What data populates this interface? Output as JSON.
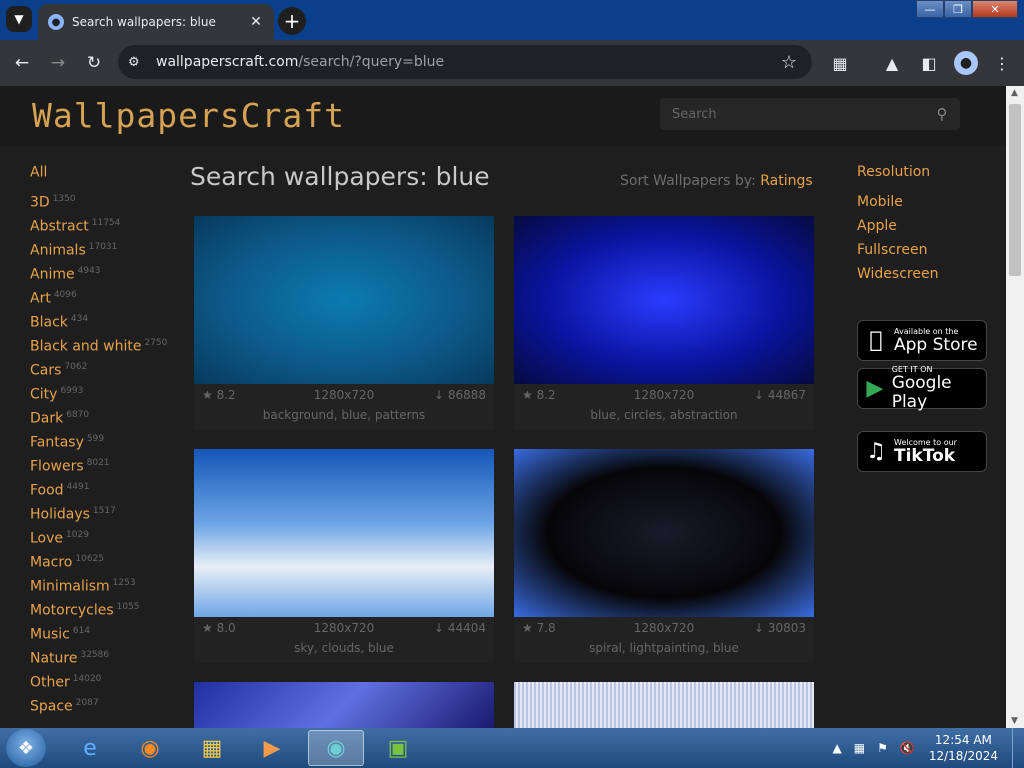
{
  "browser": {
    "tab_title": "Search wallpapers: blue",
    "url_host": "wallpaperscraft.com",
    "url_path": "/search/?query=blue"
  },
  "site": {
    "logo": "WallpapersCraft",
    "search_placeholder": "Search",
    "heading": "Search wallpapers: blue",
    "sort_label": "Sort Wallpapers by:",
    "sort_value": "Ratings"
  },
  "categories": [
    {
      "name": "All",
      "count": ""
    },
    {
      "name": "3D",
      "count": "1350"
    },
    {
      "name": "Abstract",
      "count": "11754"
    },
    {
      "name": "Animals",
      "count": "17031"
    },
    {
      "name": "Anime",
      "count": "4943"
    },
    {
      "name": "Art",
      "count": "4096"
    },
    {
      "name": "Black",
      "count": "434"
    },
    {
      "name": "Black and white",
      "count": "2750"
    },
    {
      "name": "Cars",
      "count": "7062"
    },
    {
      "name": "City",
      "count": "6993"
    },
    {
      "name": "Dark",
      "count": "6870"
    },
    {
      "name": "Fantasy",
      "count": "599"
    },
    {
      "name": "Flowers",
      "count": "8021"
    },
    {
      "name": "Food",
      "count": "4491"
    },
    {
      "name": "Holidays",
      "count": "1517"
    },
    {
      "name": "Love",
      "count": "1029"
    },
    {
      "name": "Macro",
      "count": "10625"
    },
    {
      "name": "Minimalism",
      "count": "1253"
    },
    {
      "name": "Motorcycles",
      "count": "1055"
    },
    {
      "name": "Music",
      "count": "614"
    },
    {
      "name": "Nature",
      "count": "32586"
    },
    {
      "name": "Other",
      "count": "14020"
    },
    {
      "name": "Space",
      "count": "2087"
    }
  ],
  "wallpapers": [
    {
      "rating": "8.2",
      "resolution": "1280x720",
      "downloads": "86888",
      "tags": "background, blue, patterns",
      "colors": [
        "#0d5a8a",
        "#0b7bb0",
        "#063a5c"
      ]
    },
    {
      "rating": "8.2",
      "resolution": "1280x720",
      "downloads": "44867",
      "tags": "blue, circles, abstraction",
      "colors": [
        "#0a14a0",
        "#2b3cff",
        "#050a40"
      ]
    },
    {
      "rating": "8.0",
      "resolution": "1280x720",
      "downloads": "44404",
      "tags": "sky, clouds, blue",
      "colors": [
        "#1456b8",
        "#6ea6e6",
        "#e8eef6"
      ]
    },
    {
      "rating": "7.8",
      "resolution": "1280x720",
      "downloads": "30803",
      "tags": "spiral, lightpainting, blue",
      "colors": [
        "#060608",
        "#1a1a2a",
        "#3a6ce0"
      ]
    }
  ],
  "resolution": {
    "heading": "Resolution",
    "items": [
      "Mobile",
      "Apple",
      "Fullscreen",
      "Widescreen"
    ]
  },
  "stores": {
    "appstore_small": "Available on the",
    "appstore_big": "App Store",
    "googleplay_small": "GET IT ON",
    "googleplay_big": "Google Play",
    "tiktok_small": "Welcome to our",
    "tiktok_big": "TikTok"
  },
  "taskbar": {
    "time": "12:54 AM",
    "date": "12/18/2024"
  }
}
